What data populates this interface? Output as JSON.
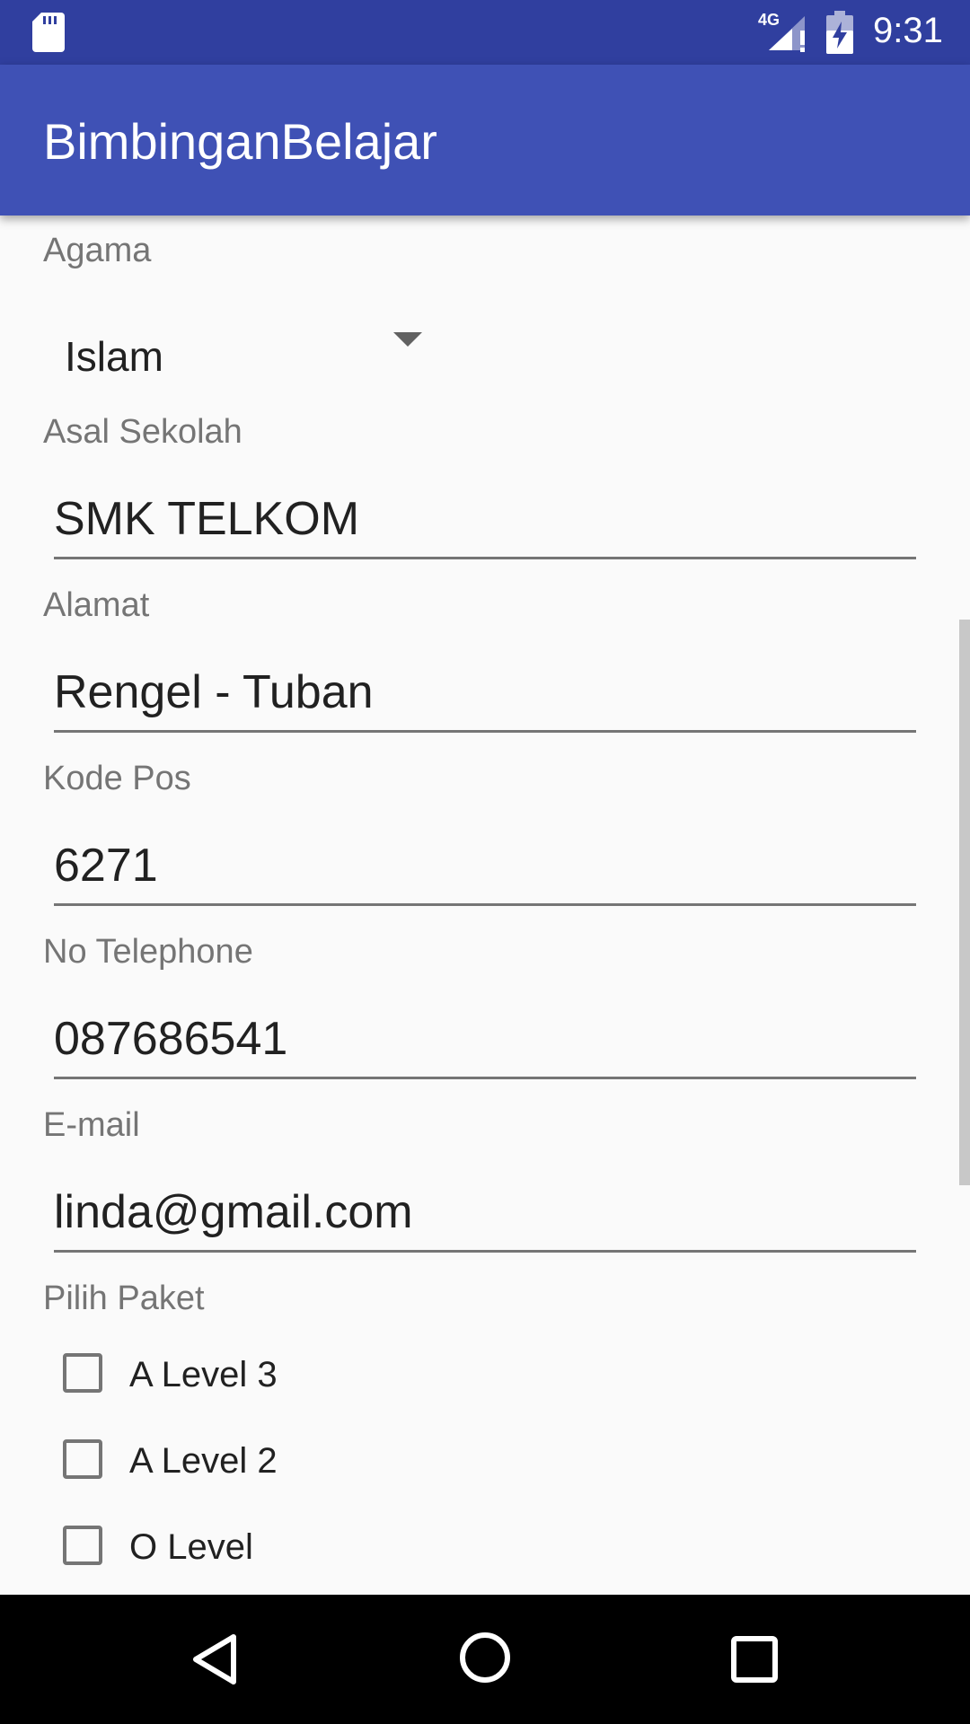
{
  "status_bar": {
    "network": "4G",
    "time": "9:31",
    "icons": [
      "sd-card-icon",
      "signal-icon",
      "battery-charging-icon"
    ]
  },
  "app_bar": {
    "title": "BimbinganBelajar"
  },
  "form": {
    "agama": {
      "label": "Agama",
      "selected": "Islam"
    },
    "asal_sekolah": {
      "label": "Asal Sekolah",
      "value": "SMK TELKOM"
    },
    "alamat": {
      "label": "Alamat",
      "value": "Rengel - Tuban"
    },
    "kode_pos": {
      "label": "Kode Pos",
      "value": "6271"
    },
    "no_telephone": {
      "label": "No Telephone",
      "value": "087686541"
    },
    "email": {
      "label": "E-mail",
      "value": "linda@gmail.com"
    },
    "paket": {
      "label": "Pilih Paket",
      "options": [
        {
          "label": "A Level 3",
          "checked": false
        },
        {
          "label": "A Level 2",
          "checked": false
        },
        {
          "label": "O Level",
          "checked": false
        }
      ]
    }
  },
  "nav_bar": {
    "icons": [
      "back-icon",
      "home-icon",
      "recents-icon"
    ]
  },
  "colors": {
    "primary": "#3f51b5",
    "primary_dark": "#303f9f",
    "background": "#fafafa",
    "label_gray": "#757575",
    "text": "#212121"
  }
}
